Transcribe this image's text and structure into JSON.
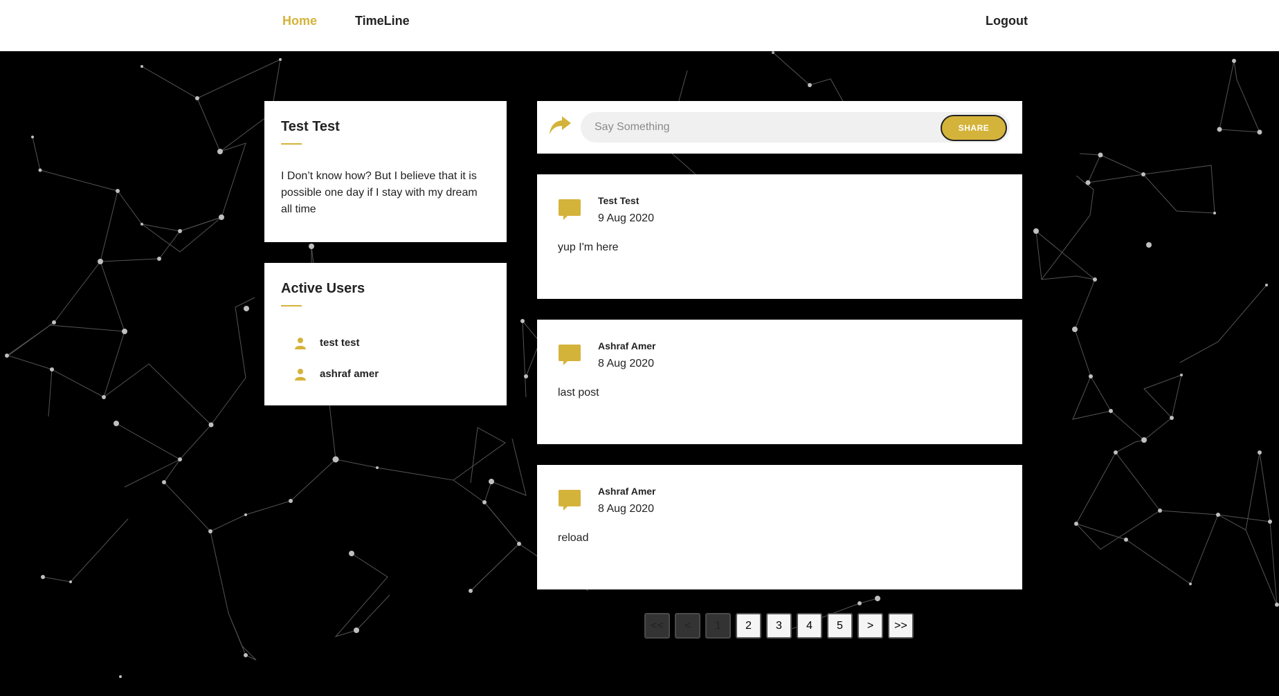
{
  "nav": {
    "home": "Home",
    "timeline": "TimeLine",
    "logout": "Logout"
  },
  "profile": {
    "name": "Test Test",
    "bio": "I Don’t know how? But I believe that it is possible one day if I stay with my dream all time"
  },
  "active_users": {
    "title": "Active Users",
    "users": [
      {
        "name": "test test"
      },
      {
        "name": "ashraf amer"
      }
    ]
  },
  "share": {
    "placeholder": "Say Something",
    "button_label": "SHARE"
  },
  "posts": [
    {
      "author": "Test Test",
      "date": "9 Aug 2020",
      "body": "yup I'm here"
    },
    {
      "author": "Ashraf Amer",
      "date": "8 Aug 2020",
      "body": "last post"
    },
    {
      "author": "Ashraf Amer",
      "date": "8 Aug 2020",
      "body": "reload"
    }
  ],
  "pagination": {
    "first": "<<",
    "prev": "<",
    "pages": [
      "1",
      "2",
      "3",
      "4",
      "5"
    ],
    "next": ">",
    "last": ">>",
    "current_page": 1
  },
  "colors": {
    "accent": "#d4b33a",
    "background": "#000000",
    "card": "#ffffff"
  },
  "icons": {
    "share": "share-arrow-icon",
    "post": "comment-bubble-icon",
    "user": "user-icon"
  }
}
